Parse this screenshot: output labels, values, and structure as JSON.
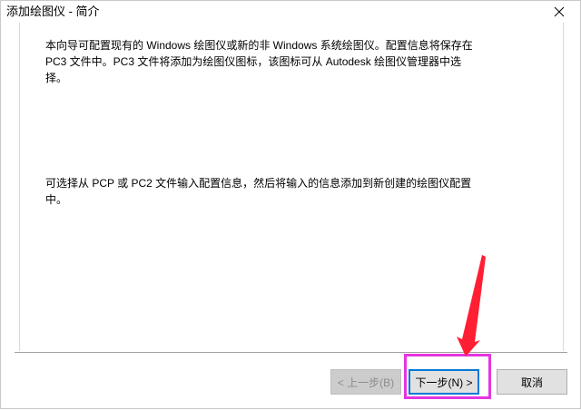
{
  "window": {
    "title": "添加绘图仪 - 简介"
  },
  "content": {
    "paragraph_1": "本向导可配置现有的 Windows 绘图仪或新的非 Windows 系统绘图仪。配置信息将保存在 PC3 文件中。PC3 文件将添加为绘图仪图标，该图标可从 Autodesk 绘图仪管理器中选择。",
    "paragraph_2": "可选择从 PCP 或 PC2 文件输入配置信息，然后将输入的信息添加到新创建的绘图仪配置中。"
  },
  "buttons": {
    "back_label": "< 上一步(B)",
    "next_label": "下一步(N) >",
    "cancel_label": "取消"
  },
  "annotation": {
    "highlight_color": "#e535e0",
    "arrow_color": "#ff1e32"
  },
  "icons": {
    "close": "close-icon"
  }
}
